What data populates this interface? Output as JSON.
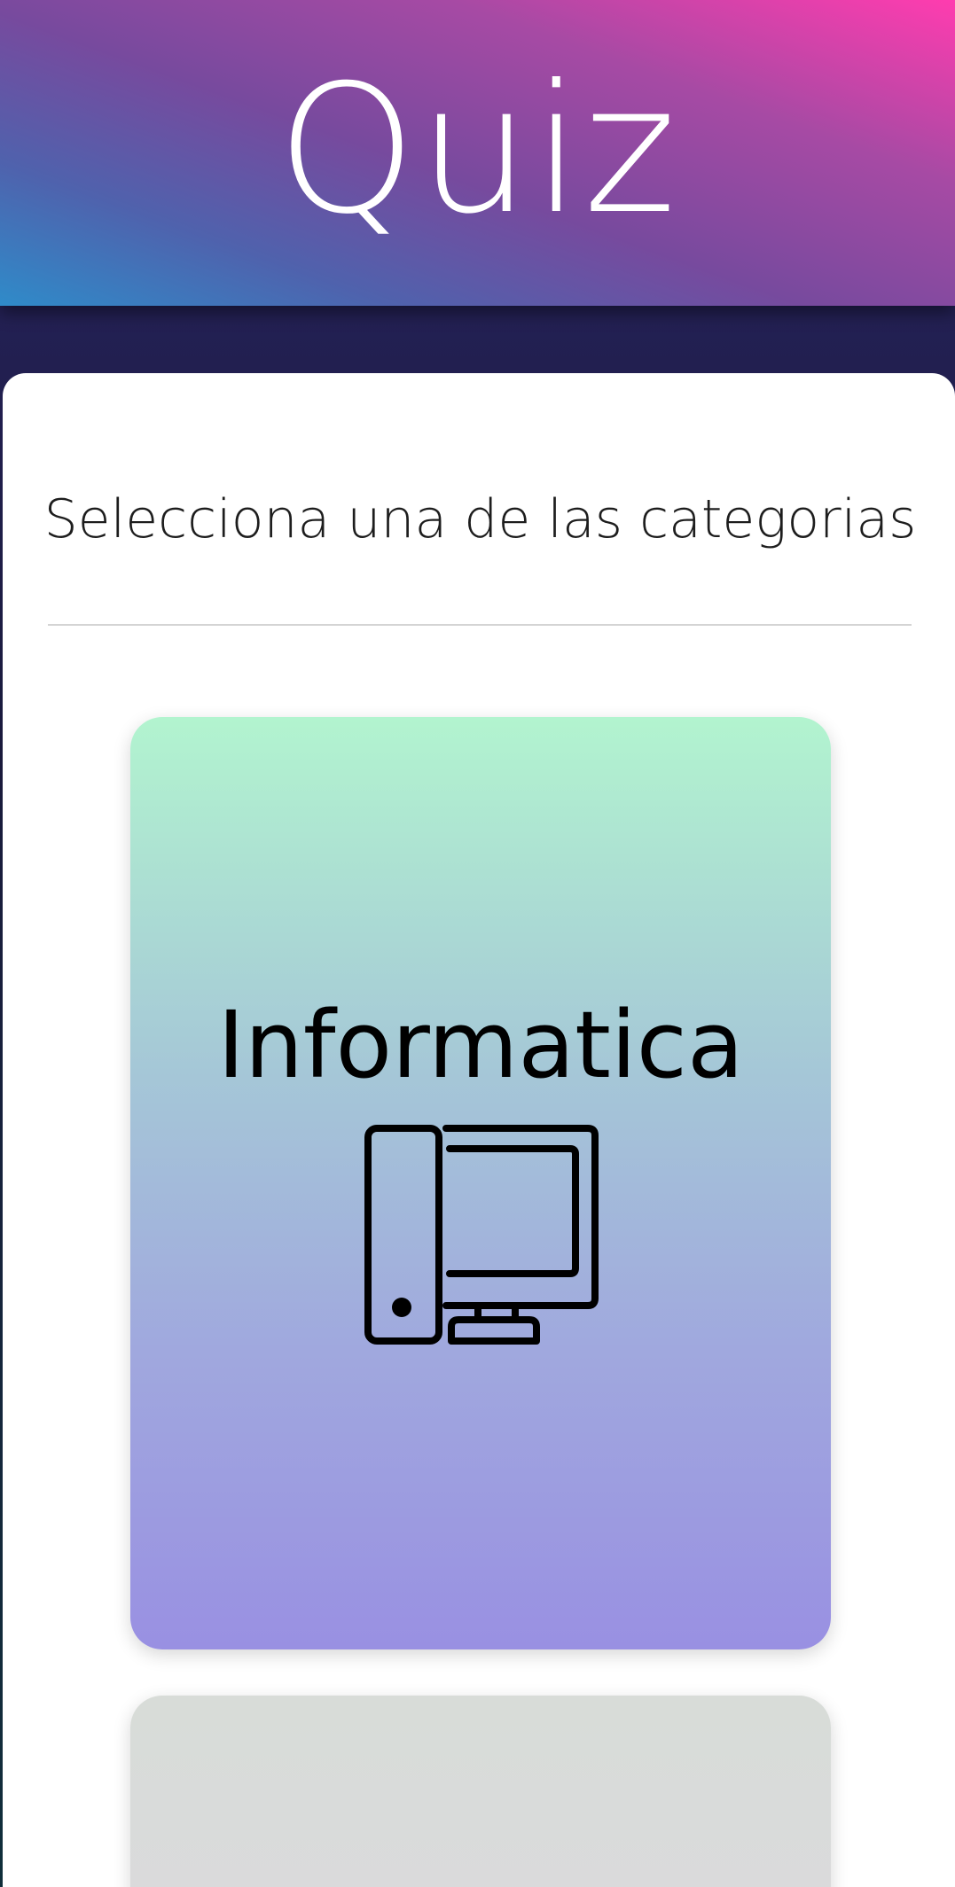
{
  "header": {
    "title": "Quiz",
    "gradient_colors": [
      "#2f8bc9",
      "#774a9e",
      "#ff3caf"
    ]
  },
  "main": {
    "prompt": "Selecciona una de las categorias",
    "categories": [
      {
        "label": "Informatica",
        "icon": "desktop-computer-icon",
        "gradient_colors": [
          "#b2f4cf",
          "#9990e2"
        ]
      },
      {
        "label": "",
        "icon": "",
        "gradient_colors": [
          "#d8dcd8",
          "#dadadc"
        ]
      }
    ]
  }
}
